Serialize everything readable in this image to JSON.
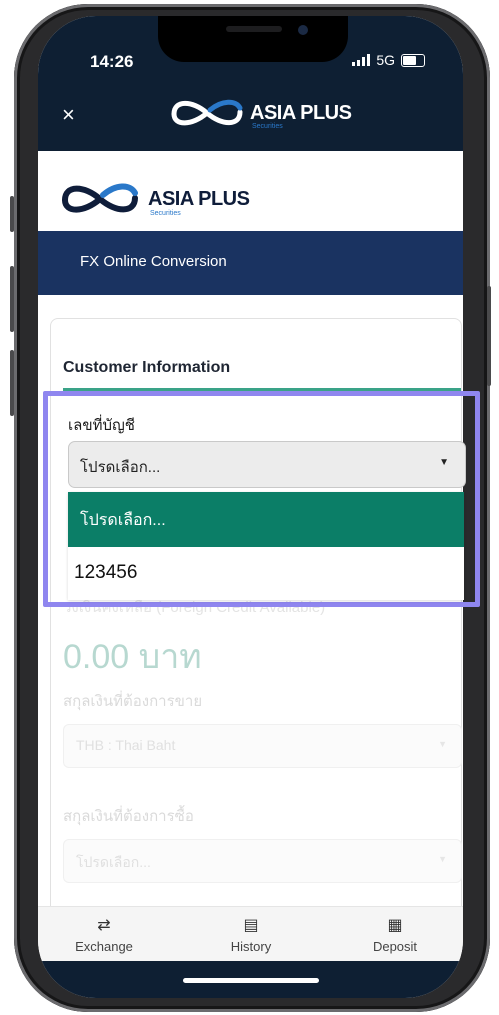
{
  "status_bar": {
    "time": "14:26",
    "network": "5G"
  },
  "header": {
    "close_symbol": "×",
    "logo_text": "ASIA PLUS",
    "logo_sub": "Securities"
  },
  "brand": {
    "logo_text": "ASIA PLUS",
    "logo_sub": "Securities"
  },
  "banner": {
    "title": "FX Online Conversion"
  },
  "card": {
    "title": "Customer Information"
  },
  "account": {
    "label": "เลขที่บัญชี",
    "selected": "โปรดเลือก...",
    "options": [
      "โปรดเลือก...",
      "123456"
    ]
  },
  "behind": {
    "credit_label": "วงเงินคงเหลือ (Foreign Credit Available)",
    "credit_value": "0.00 บาท",
    "sell_label": "สกุลเงินที่ต้องการขาย",
    "sell_value": "THB : Thai Baht",
    "buy_label": "สกุลเงินที่ต้องการซื้อ",
    "buy_value": "โปรดเลือก..."
  },
  "bottom_nav": [
    {
      "label": "Exchange",
      "icon": "exchange-icon"
    },
    {
      "label": "History",
      "icon": "history-icon"
    },
    {
      "label": "Deposit",
      "icon": "qr-code-icon"
    }
  ],
  "colors": {
    "header_bg": "#0e1f33",
    "banner_bg": "#1a3361",
    "accent_green": "#3aa388",
    "selected_option_bg": "#0b7e67",
    "highlight_border": "#8f86ef"
  }
}
